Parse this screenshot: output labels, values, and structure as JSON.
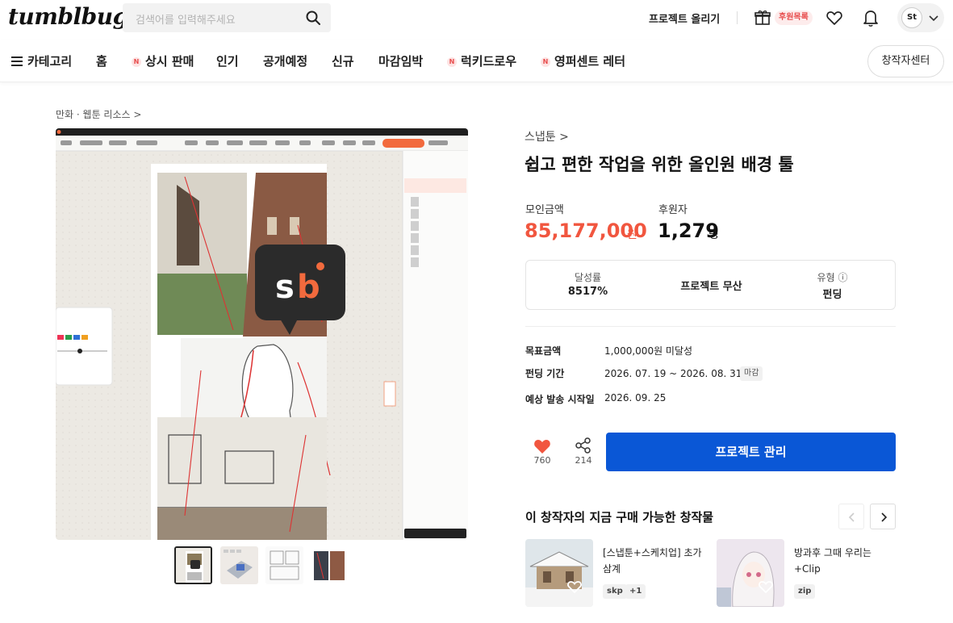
{
  "header": {
    "logo": "tumblbug",
    "search_placeholder": "검색어를 입력해주세요",
    "upload_label": "프로젝트 올리기",
    "gift_badge": "후원목록",
    "avatar_text": "St"
  },
  "nav": {
    "items": [
      {
        "label": "카테고리",
        "badge": ""
      },
      {
        "label": "홈",
        "badge": ""
      },
      {
        "label": "상시 판매",
        "badge": "N"
      },
      {
        "label": "인기",
        "badge": ""
      },
      {
        "label": "공개예정",
        "badge": ""
      },
      {
        "label": "신규",
        "badge": ""
      },
      {
        "label": "마감임박",
        "badge": ""
      },
      {
        "label": "럭키드로우",
        "badge": "N"
      },
      {
        "label": "영퍼센트 레터",
        "badge": "N"
      }
    ],
    "creator_center": "창작자센터"
  },
  "breadcrumb": "만화 · 웹툰 리소스 >",
  "media": {
    "logo_text": "Sb"
  },
  "project": {
    "category": "스냅툰 >",
    "title": "쉽고 편한 작업을 위한 올인원 배경 툴",
    "raised_label": "모인금액",
    "raised_value": "85,177,000",
    "raised_unit": "원",
    "backers_label": "후원자",
    "backers_value": "1,279",
    "backers_unit": "명",
    "summary": [
      {
        "label": "달성률",
        "value": "8517%"
      },
      {
        "label": "",
        "value": "프로젝트 무산"
      },
      {
        "label": "유형 ⓘ",
        "value": "펀딩"
      }
    ],
    "info": [
      {
        "label": "목표금액",
        "value": "1,000,000원 미달성"
      },
      {
        "label": "펀딩 기간",
        "value": "2026. 07. 19 ~ 2026. 08. 31"
      },
      {
        "label": "예상 발송 시작일",
        "value": "2026. 09. 25"
      }
    ],
    "deadline_badge": "마감",
    "likes": "760",
    "shares": "214",
    "manage_label": "프로젝트 관리"
  },
  "recommend": {
    "title": "이 창작자의 지금 구매 가능한 창작물",
    "cards": [
      {
        "title": "[스냅툰+스케치업] 초가삼계",
        "tags": [
          "skp",
          "+1"
        ]
      },
      {
        "title": "방과후 그때 우리는 +Clip",
        "tags": [
          "zip"
        ]
      }
    ]
  },
  "colors": {
    "accent_red": "#f1563f",
    "primary_blue": "#0a57d6",
    "brand_orange": "#f26a3d"
  }
}
